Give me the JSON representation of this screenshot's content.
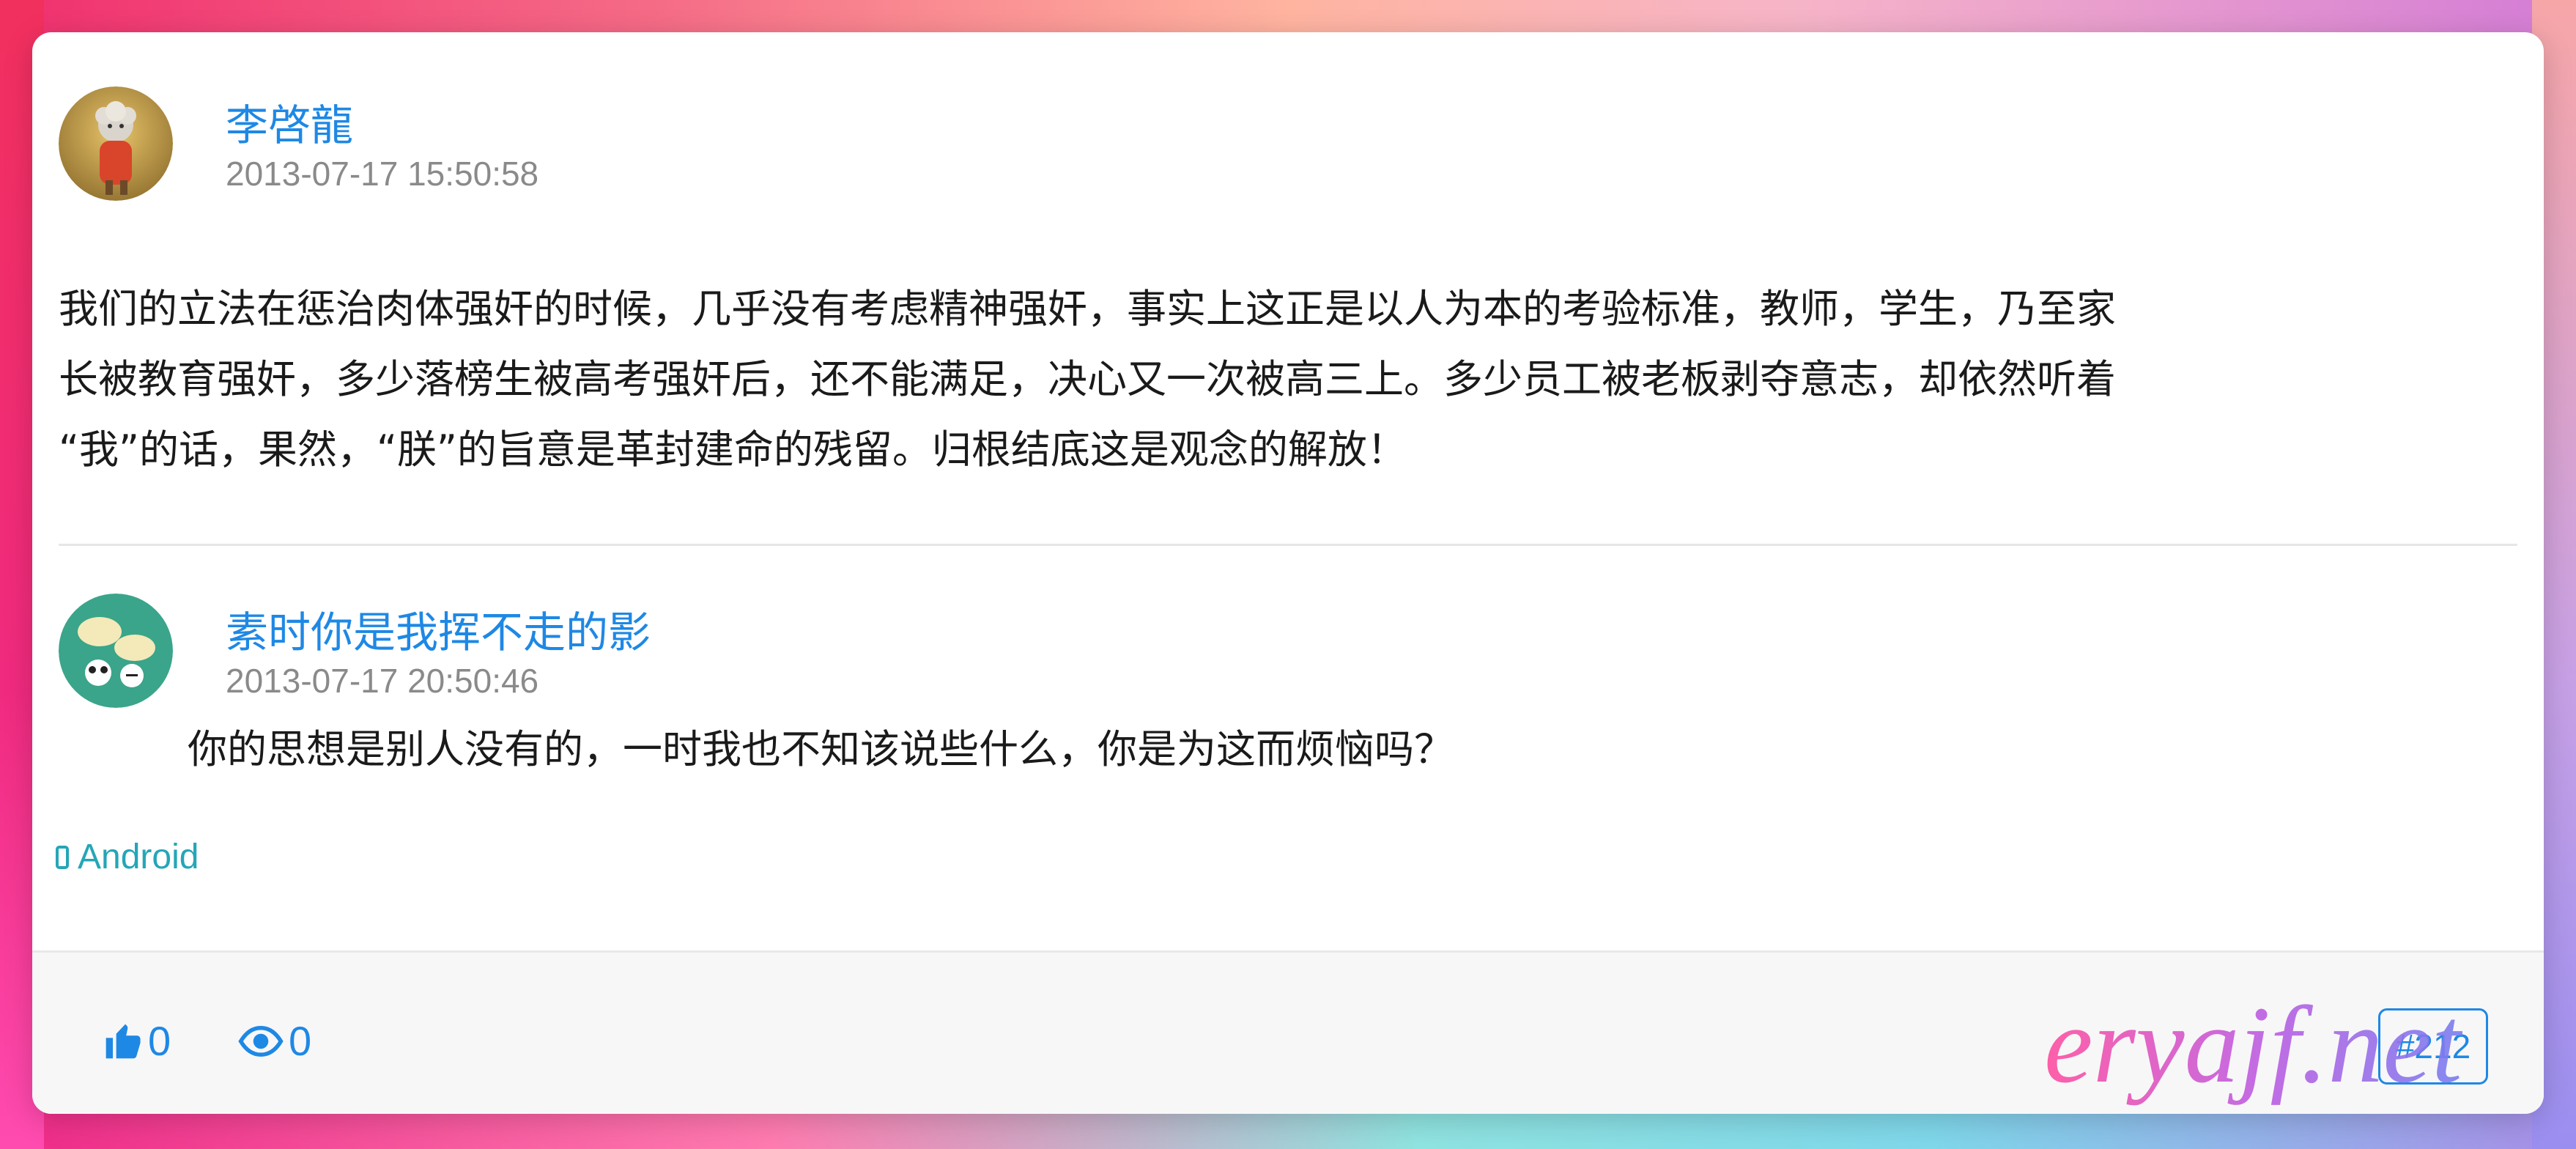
{
  "post": {
    "author": "李啓龍",
    "timestamp": "2013-07-17 15:50:58",
    "body_lines": [
      "我们的立法在惩治肉体强奸的时候，几乎没有考虑精神强奸，事实上这正是以人为本的考验标准，教师，学生，乃至家",
      "长被教育强奸，多少落榜生被高考强奸后，还不能满足，决心又一次被高三上。多少员工被老板剥夺意志，却依然听着",
      "“我”的话，果然，“朕”的旨意是革封建命的残留。归根结底这是观念的解放！"
    ]
  },
  "reply": {
    "author": "素时你是我挥不走的影",
    "timestamp": "2013-07-17 20:50:46",
    "text": "你的思想是别人没有的，一时我也不知该说些什么，你是为这而烦恼吗？"
  },
  "device": {
    "label": "Android",
    "icon": "phone-icon"
  },
  "footer": {
    "likes": "0",
    "views": "0",
    "floor": "#212"
  },
  "watermark": "eryajf.net",
  "colors": {
    "accent": "#1e88e5",
    "device": "#25a6b7",
    "muted": "#8a8a8a"
  }
}
